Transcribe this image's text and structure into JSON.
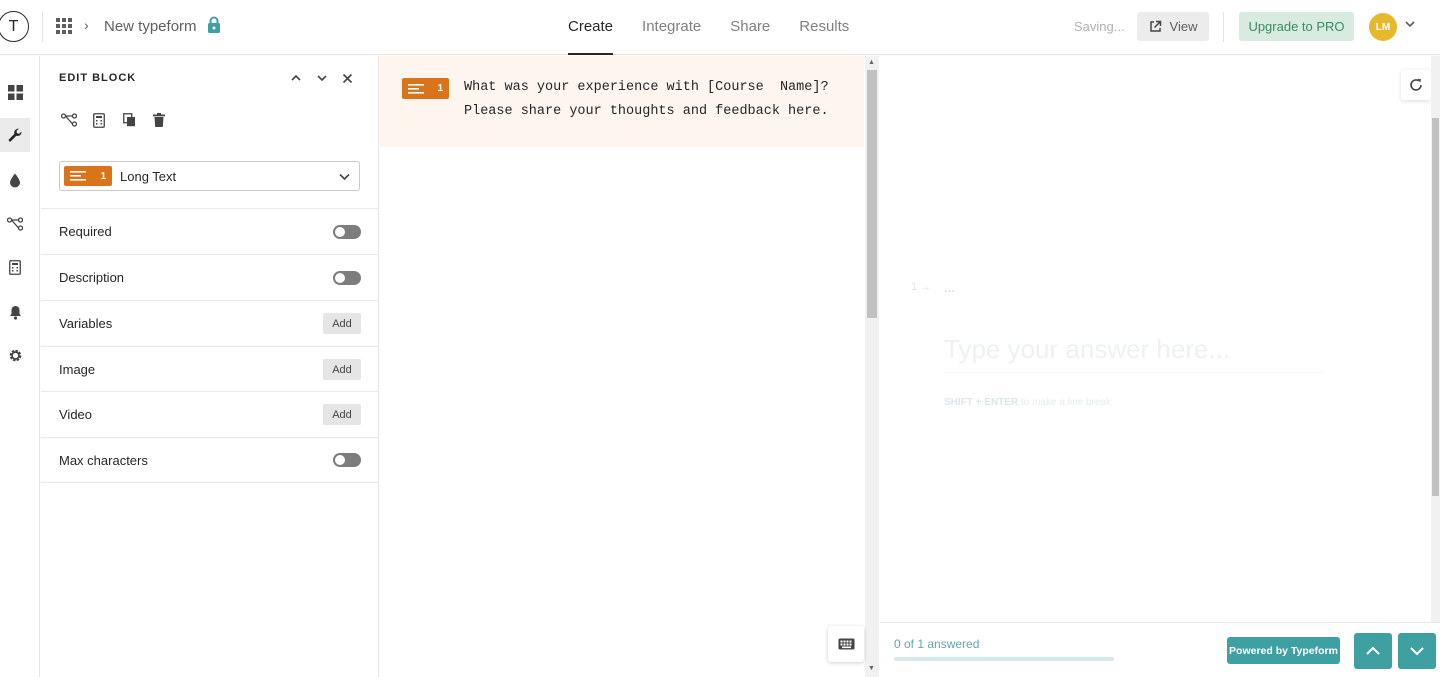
{
  "header": {
    "logo_letter": "T",
    "form_name": "New typeform",
    "tabs": [
      {
        "label": "Create",
        "active": true
      },
      {
        "label": "Integrate",
        "active": false
      },
      {
        "label": "Share",
        "active": false
      },
      {
        "label": "Results",
        "active": false
      }
    ],
    "saving_status": "Saving...",
    "view_label": "View",
    "upgrade_label": "Upgrade to PRO",
    "avatar_initials": "LM"
  },
  "rail": {
    "items": [
      "dashboard-icon",
      "wrench-icon",
      "droplet-icon",
      "logic-icon",
      "calculator-icon",
      "bell-icon",
      "gear-icon"
    ],
    "active": "wrench-icon"
  },
  "panel": {
    "title": "EDIT BLOCK",
    "block_type": {
      "number": "1",
      "label": "Long Text"
    },
    "settings": [
      {
        "label": "Required",
        "control": "toggle",
        "on": false
      },
      {
        "label": "Description",
        "control": "toggle",
        "on": false
      },
      {
        "label": "Variables",
        "control": "button",
        "button_label": "Add"
      },
      {
        "label": "Image",
        "control": "button",
        "button_label": "Add"
      },
      {
        "label": "Video",
        "control": "button",
        "button_label": "Add"
      },
      {
        "label": "Max characters",
        "control": "toggle",
        "on": false
      }
    ]
  },
  "question": {
    "number": "1",
    "text_line1": "What was your experience with [Course  Name]?",
    "text_line2": "Please share your thoughts and feedback here."
  },
  "preview": {
    "question_number": "1 →",
    "question_placeholder": "...",
    "answer_placeholder": "Type your answer here...",
    "hint_keys": "SHIFT + ENTER",
    "hint_text": " to make a line break",
    "answered_text": "0 of 1 answered",
    "progress_fraction": 0,
    "powered_by": "Powered by Typeform"
  },
  "colors": {
    "accent_orange": "#d9741b",
    "preview_teal": "#3fa0a2",
    "avatar_yellow": "#e6b82b",
    "upgrade_green": "#3e8a61"
  }
}
